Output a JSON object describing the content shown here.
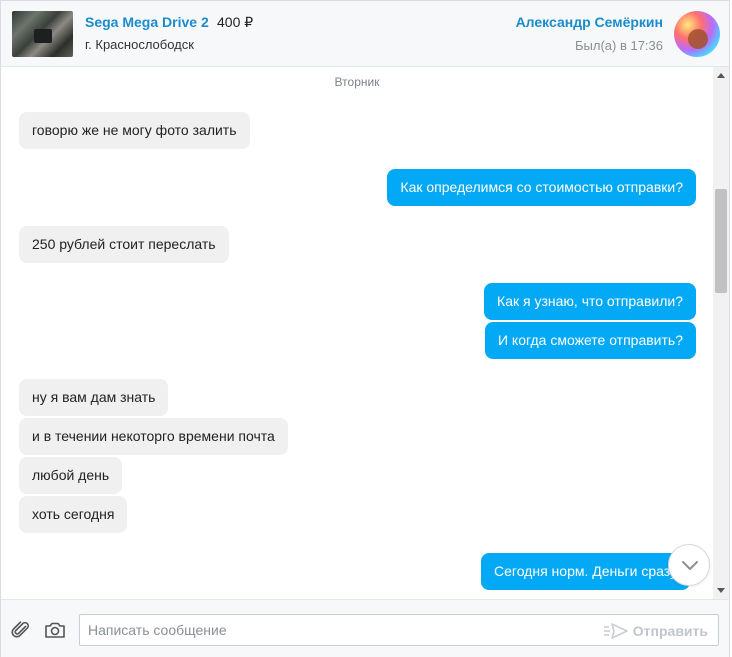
{
  "header": {
    "product_title": "Sega Mega Drive 2",
    "product_price": "400 ₽",
    "product_city": "г. Краснослободск",
    "user_name": "Александр Семёркин",
    "last_seen": "Был(а) в 17:36"
  },
  "chat": {
    "day_label": "Вторник",
    "messages": [
      {
        "dir": "in",
        "text": "говорю же не могу фото залить"
      },
      {
        "dir": "out",
        "text": "Как определимся со стоимостью отправки?"
      },
      {
        "dir": "in",
        "text": "250 рублей стоит переслать"
      },
      {
        "dir": "out",
        "text": "Как я узнаю, что отправили?"
      },
      {
        "dir": "out",
        "text": "И когда сможете отправить?"
      },
      {
        "dir": "in",
        "text": "ну я вам дам знать"
      },
      {
        "dir": "in",
        "text": "и в течении некоторго времени почта"
      },
      {
        "dir": "in",
        "text": "любой день"
      },
      {
        "dir": "in",
        "text": "хоть сегодня"
      },
      {
        "dir": "out",
        "text": "Сегодня норм. Деньги сразу"
      }
    ]
  },
  "composer": {
    "placeholder": "Написать сообщение",
    "send_label": "Отправить"
  },
  "colors": {
    "accent": "#1a8ccc",
    "outgoing_bubble": "#03a9f4",
    "incoming_bubble": "#f0f0f1"
  }
}
